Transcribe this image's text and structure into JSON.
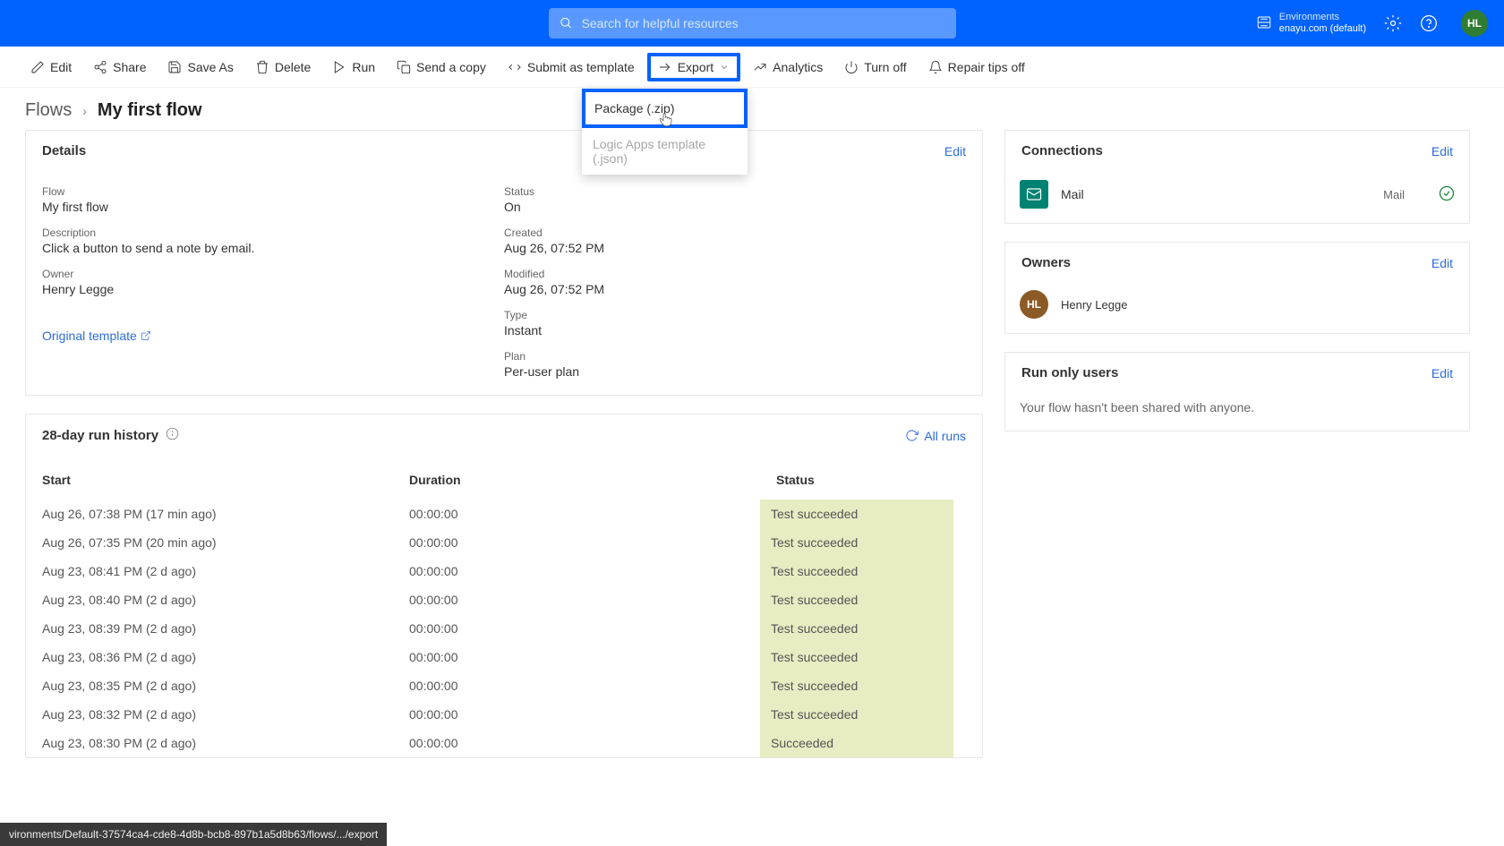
{
  "topbar": {
    "search_placeholder": "Search for helpful resources",
    "env_label": "Environments",
    "env_name": "enayu.com (default)",
    "avatar_initials": "HL"
  },
  "commandbar": {
    "edit": "Edit",
    "share": "Share",
    "save_as": "Save As",
    "delete": "Delete",
    "run": "Run",
    "send_copy": "Send a copy",
    "submit_template": "Submit as template",
    "export": "Export",
    "analytics": "Analytics",
    "turn_off": "Turn off",
    "repair_tips": "Repair tips off"
  },
  "export_menu": {
    "package": "Package (.zip)",
    "logic": "Logic Apps template (.json)"
  },
  "breadcrumb": {
    "root": "Flows",
    "title": "My first flow"
  },
  "details": {
    "header": "Details",
    "edit": "Edit",
    "flow_l": "Flow",
    "flow_v": "My first flow",
    "desc_l": "Description",
    "desc_v": "Click a button to send a note by email.",
    "owner_l": "Owner",
    "owner_v": "Henry Legge",
    "status_l": "Status",
    "status_v": "On",
    "created_l": "Created",
    "created_v": "Aug 26, 07:52 PM",
    "modified_l": "Modified",
    "modified_v": "Aug 26, 07:52 PM",
    "type_l": "Type",
    "type_v": "Instant",
    "plan_l": "Plan",
    "plan_v": "Per-user plan",
    "orig_template": "Original template"
  },
  "history": {
    "header": "28-day run history",
    "all_runs": "All runs",
    "col_start": "Start",
    "col_duration": "Duration",
    "col_status": "Status",
    "rows": [
      {
        "start": "Aug 26, 07:38 PM (17 min ago)",
        "dur": "00:00:00",
        "status": "Test succeeded"
      },
      {
        "start": "Aug 26, 07:35 PM (20 min ago)",
        "dur": "00:00:00",
        "status": "Test succeeded"
      },
      {
        "start": "Aug 23, 08:41 PM (2 d ago)",
        "dur": "00:00:00",
        "status": "Test succeeded"
      },
      {
        "start": "Aug 23, 08:40 PM (2 d ago)",
        "dur": "00:00:00",
        "status": "Test succeeded"
      },
      {
        "start": "Aug 23, 08:39 PM (2 d ago)",
        "dur": "00:00:00",
        "status": "Test succeeded"
      },
      {
        "start": "Aug 23, 08:36 PM (2 d ago)",
        "dur": "00:00:00",
        "status": "Test succeeded"
      },
      {
        "start": "Aug 23, 08:35 PM (2 d ago)",
        "dur": "00:00:00",
        "status": "Test succeeded"
      },
      {
        "start": "Aug 23, 08:32 PM (2 d ago)",
        "dur": "00:00:00",
        "status": "Test succeeded"
      },
      {
        "start": "Aug 23, 08:30 PM (2 d ago)",
        "dur": "00:00:00",
        "status": "Succeeded"
      }
    ]
  },
  "connections": {
    "header": "Connections",
    "edit": "Edit",
    "name": "Mail",
    "type": "Mail"
  },
  "owners": {
    "header": "Owners",
    "edit": "Edit",
    "initials": "HL",
    "name": "Henry Legge"
  },
  "runonly": {
    "header": "Run only users",
    "edit": "Edit",
    "msg": "Your flow hasn't been shared with anyone."
  },
  "status_bar": "vironments/Default-37574ca4-cde8-4d8b-bcb8-897b1a5d8b63/flows/.../export"
}
